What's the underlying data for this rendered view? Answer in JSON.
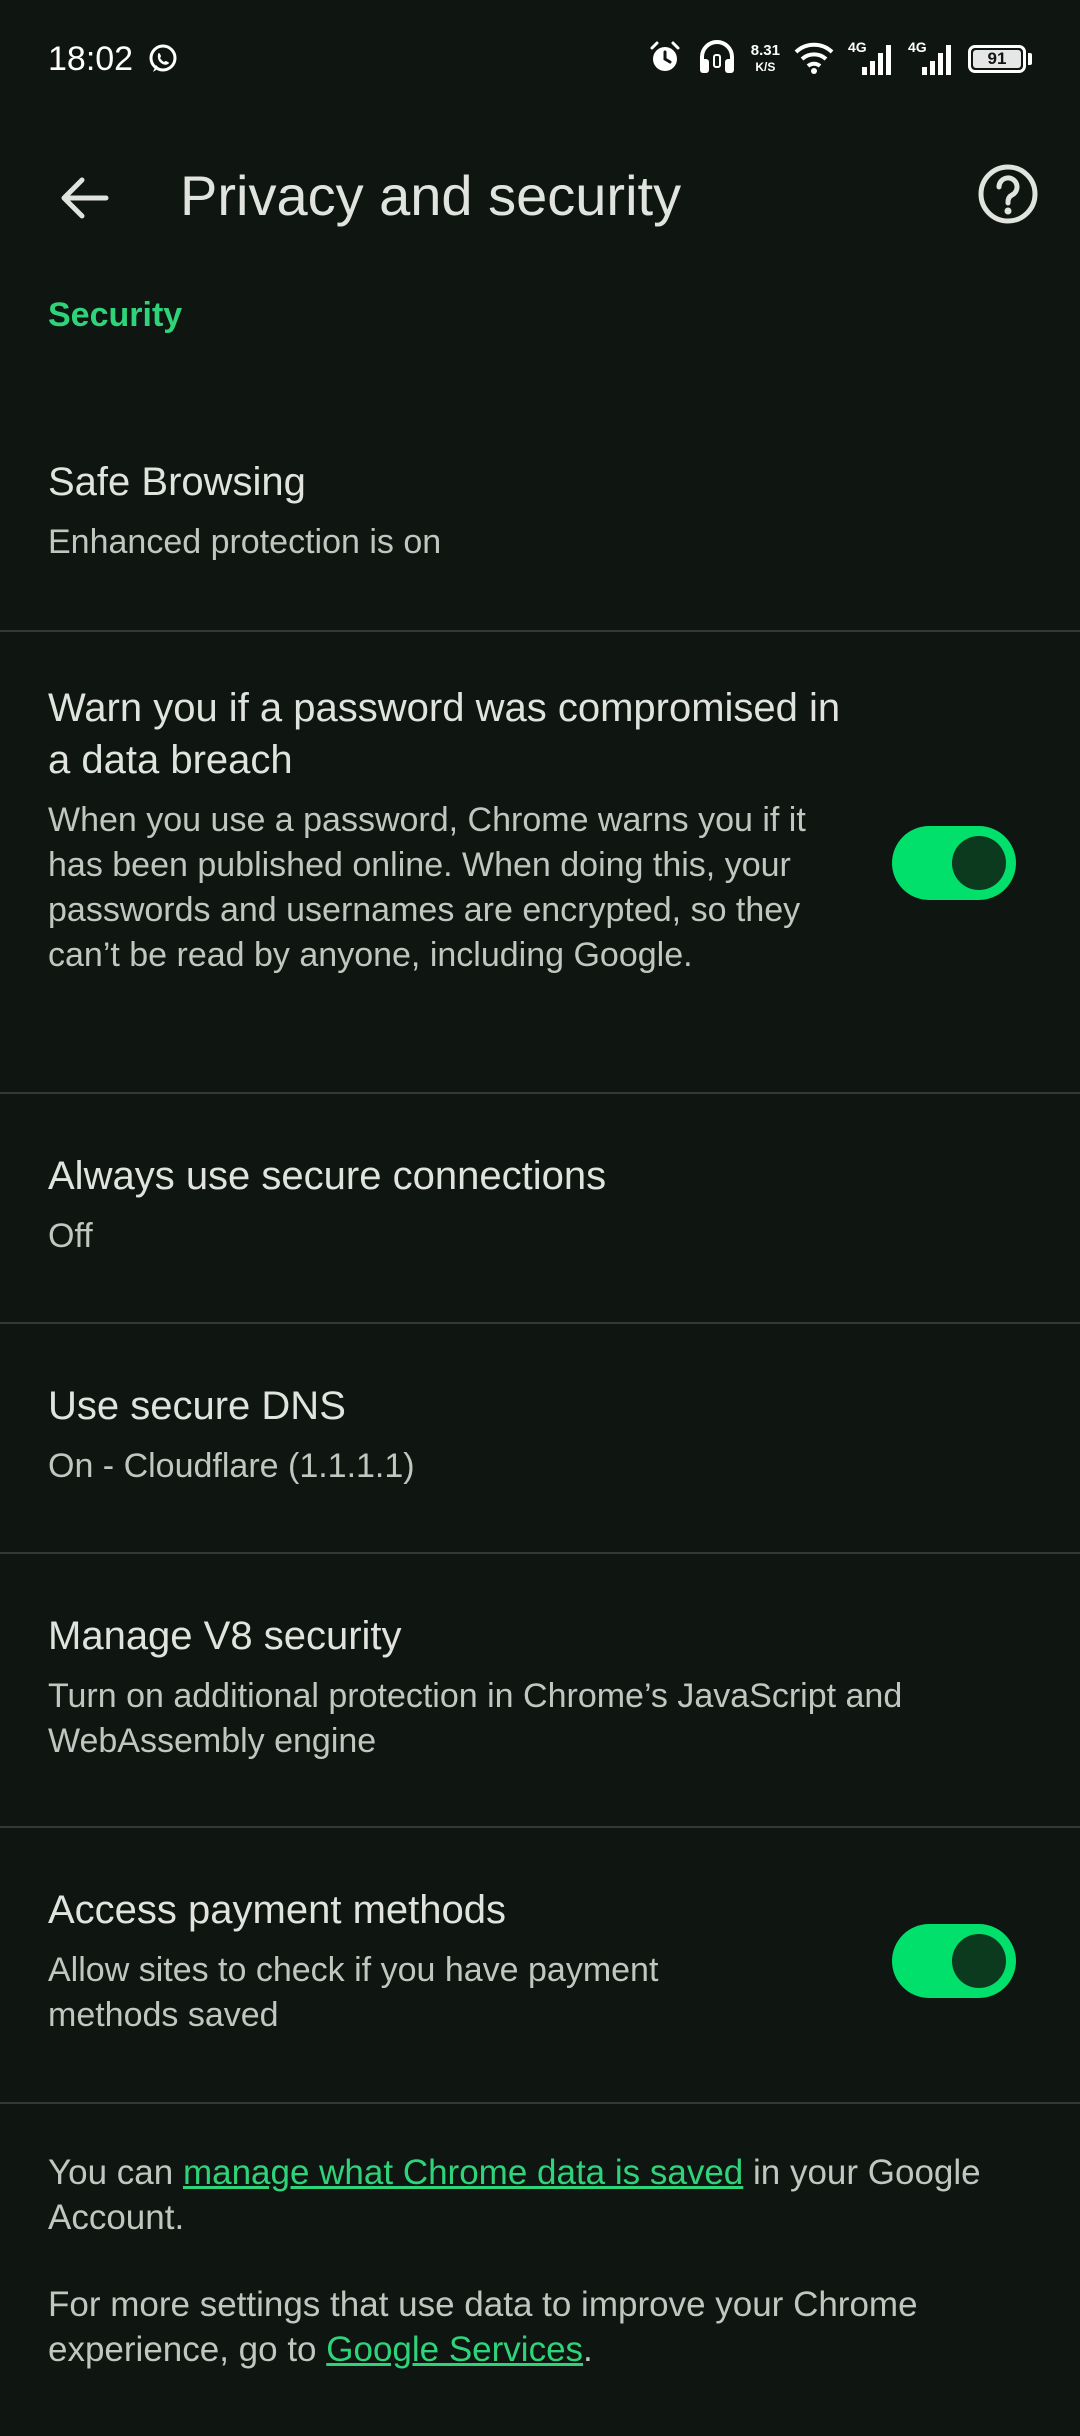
{
  "status_bar": {
    "time": "18:02",
    "netspeed_value": "8.31",
    "netspeed_unit": "K/S",
    "signal1_label": "4G",
    "signal2_label": "4G",
    "battery": "91"
  },
  "app_bar": {
    "title": "Privacy and security"
  },
  "section": {
    "header": "Security"
  },
  "items": [
    {
      "title": "Safe Browsing",
      "summary": "Enhanced protection is on"
    },
    {
      "title": "Warn you if a password was compromised in a data breach",
      "summary": "When you use a password, Chrome warns you if it has been published online. When doing this, your passwords and usernames are encrypted, so they can’t be read by anyone, including Google.",
      "toggle": true
    },
    {
      "title": "Always use secure connections",
      "summary": "Off"
    },
    {
      "title": "Use secure DNS",
      "summary": "On - Cloudflare (1.1.1.1)"
    },
    {
      "title": "Manage V8 security",
      "summary": "Turn on additional protection in Chrome’s JavaScript and WebAssembly engine"
    },
    {
      "title": "Access payment methods",
      "summary": "Allow sites to check if you have payment methods saved",
      "toggle": true
    }
  ],
  "footer": {
    "p1_before": "You can ",
    "p1_link": "manage what Chrome data is saved",
    "p1_after": " in your Google Account.",
    "p2_before": "For more settings that use data to improve your Chrome experience, go to ",
    "p2_link": "Google Services",
    "p2_after": "."
  },
  "colors": {
    "background": "#0f1511",
    "accent": "#2fd47a",
    "toggle_track": "#00e06b",
    "toggle_thumb": "#0b3a1f",
    "divider": "#333a35"
  }
}
